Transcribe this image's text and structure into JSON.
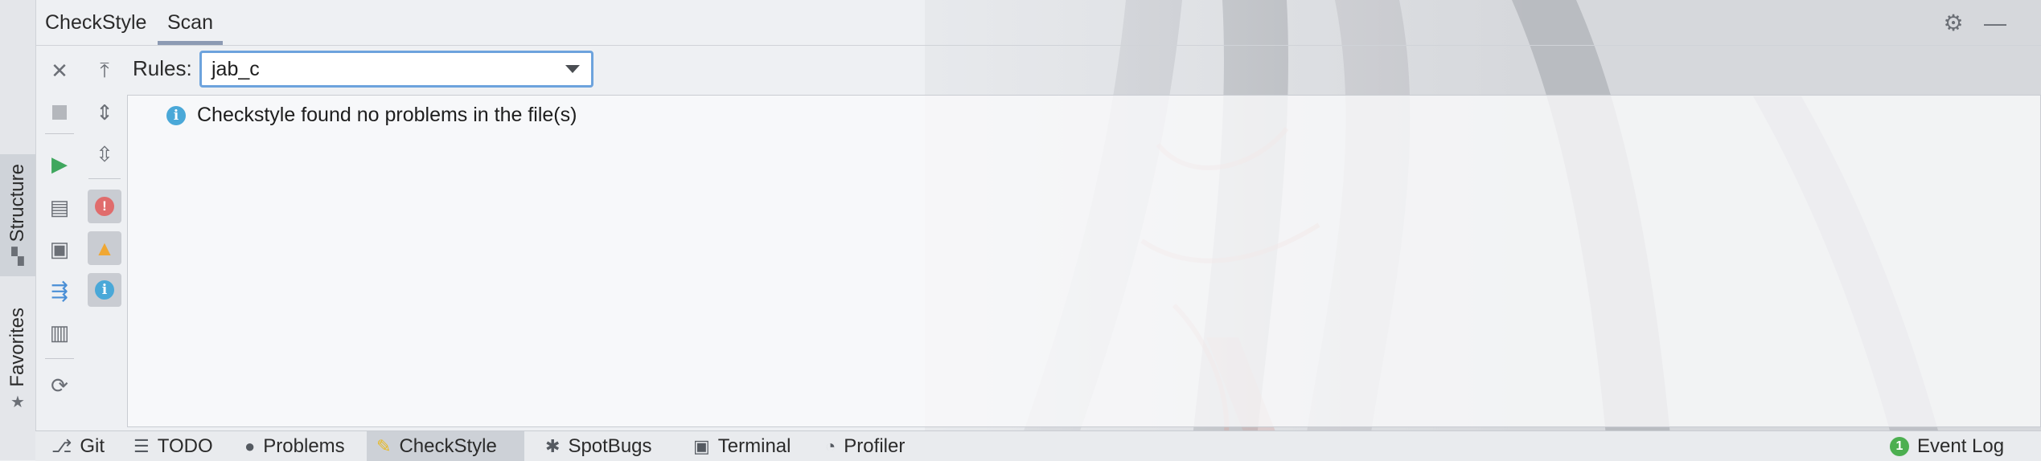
{
  "left_strip": {
    "tabs": [
      {
        "label": "Structure",
        "icon": "structure-icon"
      },
      {
        "label": "Favorites",
        "icon": "star-icon"
      }
    ]
  },
  "header": {
    "tabs": [
      {
        "label": "CheckStyle",
        "active": false
      },
      {
        "label": "Scan",
        "active": true
      }
    ],
    "icons": [
      "gear-icon",
      "minimize-icon"
    ]
  },
  "toolbar": {
    "col1": [
      "close-icon",
      "stop-icon",
      "run-icon",
      "check-module-icon",
      "check-project-icon",
      "check-changed-icon",
      "export-icon",
      "reload-icon"
    ],
    "col2": [
      "scroll-to-source-icon",
      "expand-all-icon",
      "collapse-all-icon",
      "show-errors-toggle-icon",
      "show-warnings-toggle-icon",
      "show-info-toggle-icon"
    ]
  },
  "rules": {
    "label": "Rules:",
    "selected": "jab_c"
  },
  "results": {
    "message": "Checkstyle found no problems in the file(s)",
    "icon": "info-icon"
  },
  "bottom_bar": {
    "tabs": [
      {
        "label": "Git",
        "icon": "git-icon"
      },
      {
        "label": "TODO",
        "icon": "list-icon"
      },
      {
        "label": "Problems",
        "icon": "problems-icon"
      },
      {
        "label": "CheckStyle",
        "icon": "checkstyle-icon",
        "active": true
      },
      {
        "label": "SpotBugs",
        "icon": "bug-icon"
      },
      {
        "label": "Terminal",
        "icon": "terminal-icon"
      },
      {
        "label": "Profiler",
        "icon": "profiler-icon"
      }
    ],
    "event_log": {
      "label": "Event Log",
      "count": "1"
    }
  },
  "colors": {
    "accent": "#6da3dd",
    "error": "#e06c6c",
    "warning": "#f0a732",
    "info": "#4aa8d8",
    "run": "#3fa75e",
    "event_badge": "#4caf50"
  }
}
